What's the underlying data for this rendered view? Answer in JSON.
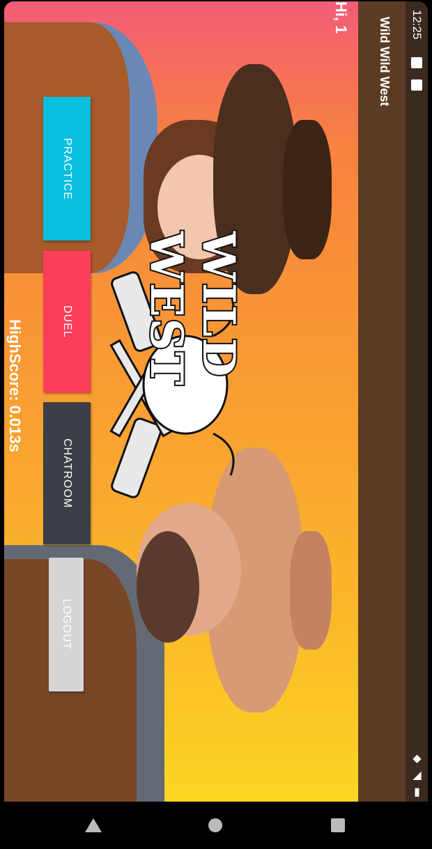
{
  "status_bar": {
    "time": "12:25"
  },
  "app_bar": {
    "title": "Wild Wild West"
  },
  "greeting": "Hi, 1",
  "logo": {
    "text": "WILD WEST"
  },
  "buttons": {
    "practice": "PRACTICE",
    "duel": "DUEL",
    "chatroom": "CHATROOM",
    "logout": "LOGOUT"
  },
  "highscore": "HighScore: 0.013s",
  "colors": {
    "practice": "#08bfdf",
    "duel": "#fd3e5b",
    "chatroom": "#3a3f45",
    "logout": "#d6d6d6",
    "app_bar": "#5c3b24"
  }
}
